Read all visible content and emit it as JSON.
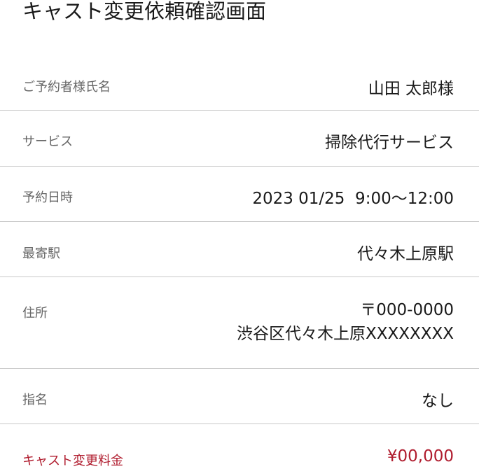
{
  "page": {
    "title": "キャスト変更依頼確認画面"
  },
  "details": {
    "customer_name": {
      "label": "ご予約者様氏名",
      "value": "山田 太郎様"
    },
    "service": {
      "label": "サービス",
      "value": "掃除代行サービス"
    },
    "datetime": {
      "label": "予約日時",
      "value": "2023 01/25  9:00〜12:00"
    },
    "station": {
      "label": "最寄駅",
      "value": "代々木上原駅"
    },
    "address": {
      "label": "住所",
      "postal": "〒000-0000",
      "street": "渋谷区代々木上原XXXXXXXX"
    },
    "nomination": {
      "label": "指名",
      "value": "なし"
    },
    "cast_change_fee": {
      "label": "キャスト変更料金",
      "value": "¥00,000"
    }
  },
  "colors": {
    "fee_accent": "#b01c2e",
    "label_text": "#666666",
    "divider": "#c9c9c9"
  }
}
